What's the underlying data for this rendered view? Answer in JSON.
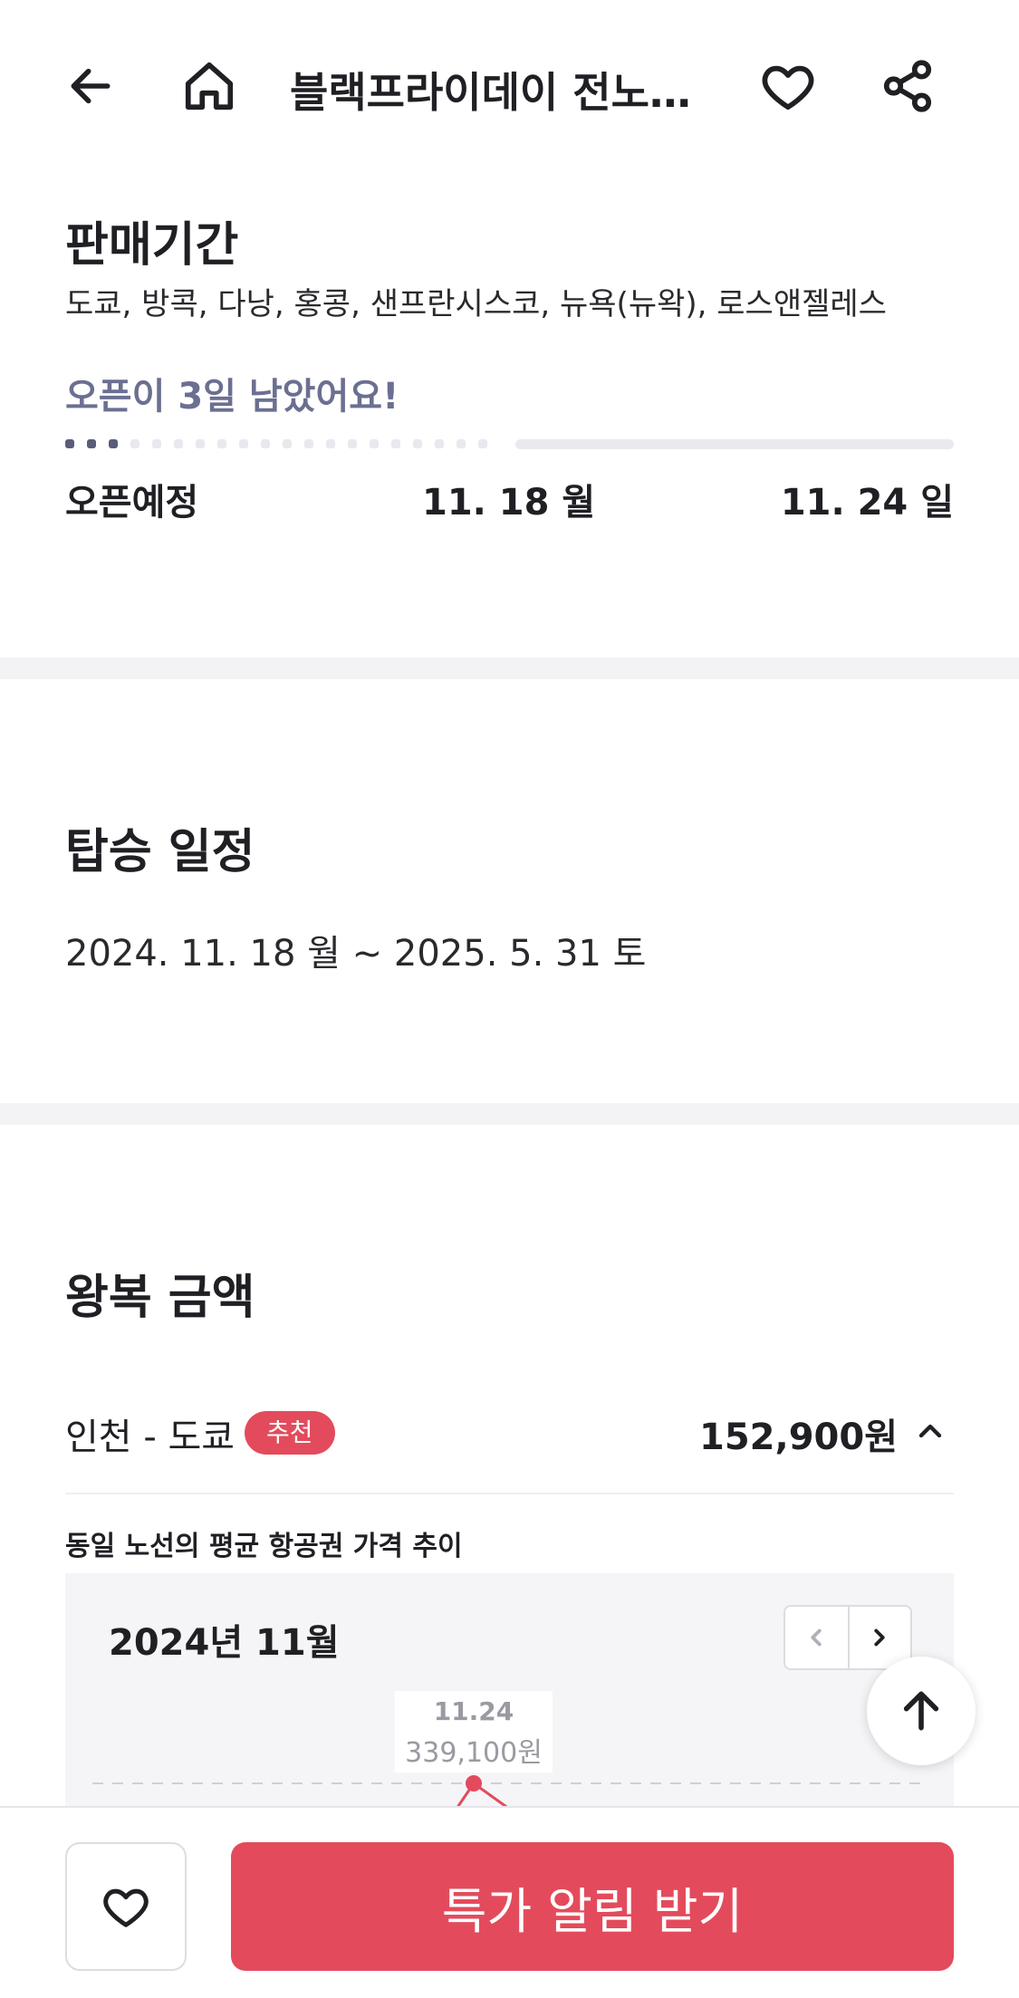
{
  "header": {
    "title": "블랙프라이데이 전노선 특가",
    "icons": [
      "arrow-left-icon",
      "home-icon",
      "heart-icon",
      "share-icon"
    ]
  },
  "sale_period": {
    "title": "판매기간",
    "destinations": "도쿄, 방콕, 다낭, 홍콩, 샌프란시스코, 뉴욕(뉴왁), 로스앤젤레스",
    "remaining": "오픈이 3일 남았어요!",
    "progress_active_dots": 3,
    "progress_total_dots": 20,
    "status_label": "오픈예정",
    "start_date": "11. 18 월",
    "end_date": "11. 24 일"
  },
  "boarding": {
    "title": "탑승 일정",
    "range": "2024. 11. 18 월 ~ 2025. 5. 31 토"
  },
  "round_trip": {
    "title": "왕복 금액",
    "route": "인천 - 도쿄",
    "badge": "추천",
    "price": "152,900원",
    "trend_label": "동일 노선의 평균 항공권 가격 추이",
    "chart": {
      "month": "2024년 11월",
      "tooltip_date": "11.24",
      "tooltip_price": "339,100원"
    }
  },
  "bottom": {
    "cta": "특가 알림 받기"
  },
  "colors": {
    "accent": "#e34b5c",
    "progress_active": "#5a5c7a",
    "remaining_text": "#6b6f91"
  }
}
